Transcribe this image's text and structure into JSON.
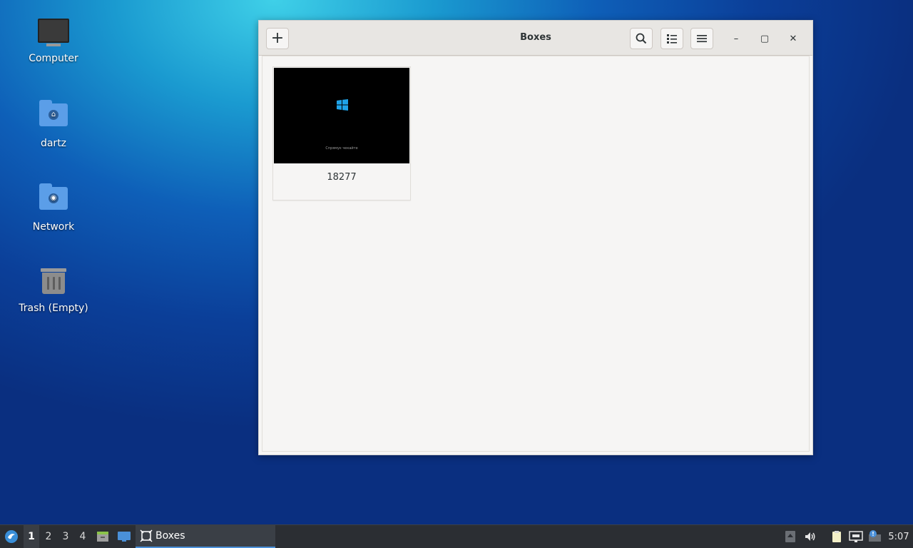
{
  "desktop": {
    "icons": [
      {
        "label": "Computer"
      },
      {
        "label": "dartz"
      },
      {
        "label": "Network"
      },
      {
        "label": "Trash (Empty)"
      }
    ]
  },
  "window": {
    "title": "Boxes",
    "add_glyph": "+",
    "search_icon": "search-icon",
    "list_view_icon": "list-view-icon",
    "menu_icon": "hamburger-menu-icon",
    "minimize_glyph": "–",
    "maximize_glyph": "▢",
    "close_glyph": "✕"
  },
  "boxes": [
    {
      "name": "18277",
      "thumbnail_os": "windows-logo-icon",
      "boot_text": "Спрямує чекайте"
    }
  ],
  "taskbar": {
    "workspaces": [
      "1",
      "2",
      "3",
      "4"
    ],
    "active_workspace": "1",
    "task_label": "Boxes",
    "clock": "5:07"
  },
  "colors": {
    "accent": "#4a90d9",
    "taskbar_bg": "#2b2e33",
    "headerbar_bg": "#e8e6e3"
  }
}
